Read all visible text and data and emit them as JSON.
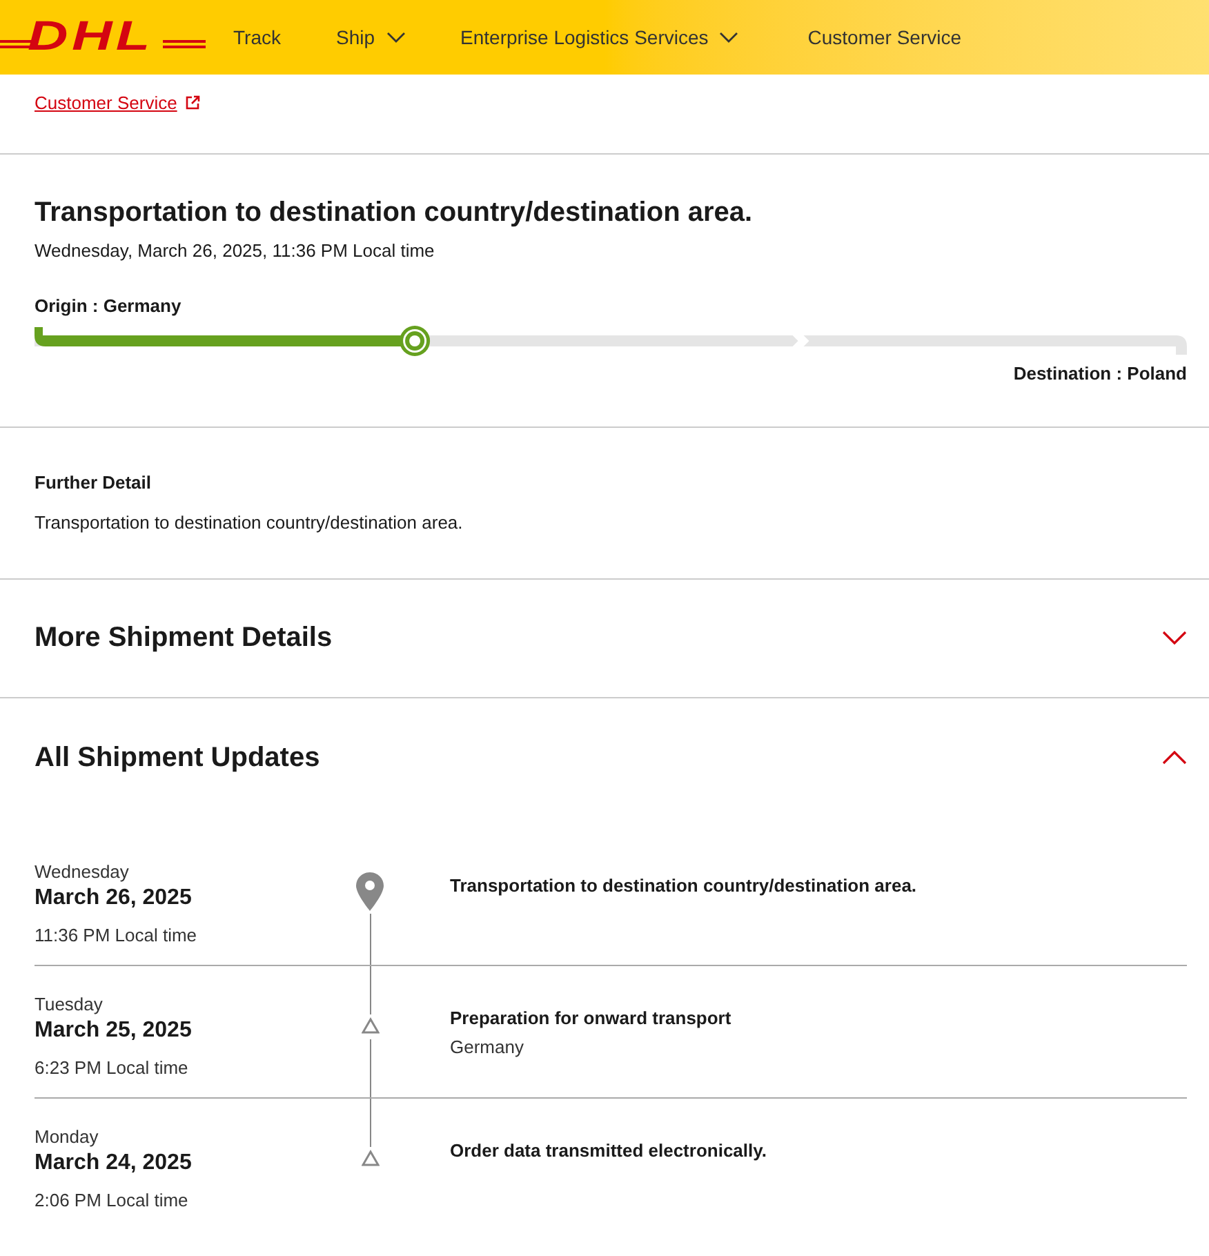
{
  "header": {
    "logo": "DHL",
    "nav": [
      {
        "label": "Track",
        "has_menu": false
      },
      {
        "label": "Ship",
        "has_menu": true
      },
      {
        "label": "Enterprise Logistics Services",
        "has_menu": true
      },
      {
        "label": "Customer Service",
        "has_menu": false
      }
    ]
  },
  "handler": {
    "link": "Customer Service"
  },
  "status": {
    "title": "Transportation to destination country/destination area.",
    "timestamp": "Wednesday, March 26, 2025, 11:36 PM Local time",
    "origin": "Origin : Germany",
    "destination": "Destination : Poland",
    "progress": {
      "level": 0.33
    }
  },
  "further_detail": {
    "heading": "Further Detail",
    "text": "Transportation to destination country/destination area."
  },
  "sections": [
    {
      "title": "More Shipment Details",
      "expanded": false
    },
    {
      "title": "All Shipment Updates",
      "expanded": true
    }
  ],
  "updates": [
    {
      "weekday": "Wednesday",
      "date": "March 26, 2025",
      "time": "11:36 PM Local time",
      "kind": "location",
      "event": "Transportation to destination country/destination area."
    },
    {
      "weekday": "Tuesday",
      "date": "March 25, 2025",
      "time": "6:23 PM Local time",
      "kind": "milestone",
      "event": "Preparation for onward transport",
      "place": "Germany"
    },
    {
      "weekday": "Monday",
      "date": "March 24, 2025",
      "time": "2:06 PM Local time",
      "kind": "milestone",
      "event": "Order data transmitted electronically."
    }
  ]
}
